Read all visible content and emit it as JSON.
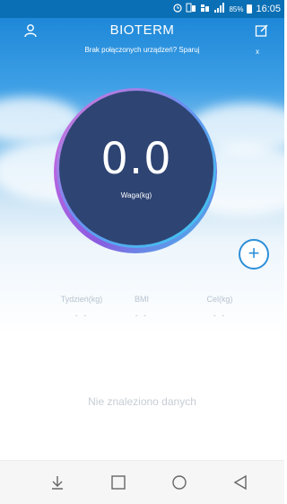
{
  "status_bar": {
    "battery_percent": "85%",
    "time": "16:05"
  },
  "header": {
    "title": "BIOTERM"
  },
  "notice": {
    "text": "Brak połączonych urządzeń? Sparuj",
    "dismiss": "x"
  },
  "gauge": {
    "value": "0.0",
    "label": "Waga(kg)"
  },
  "add_button": {
    "symbol": "+"
  },
  "stats": [
    {
      "label": "Tydzień(kg)",
      "value": "- -"
    },
    {
      "label": "BMI",
      "value": "- -"
    },
    {
      "label": "Cel(kg)",
      "value": "- -"
    }
  ],
  "empty_message": "Nie znaleziono danych",
  "icons": {
    "profile": "profile-icon",
    "edit": "edit-icon",
    "nav": [
      "download-icon",
      "square-icon",
      "circle-icon",
      "back-triangle-icon"
    ]
  },
  "colors": {
    "primary": "#1e88d8",
    "gauge": "#2e4473",
    "accent": "#2d8fd8"
  }
}
